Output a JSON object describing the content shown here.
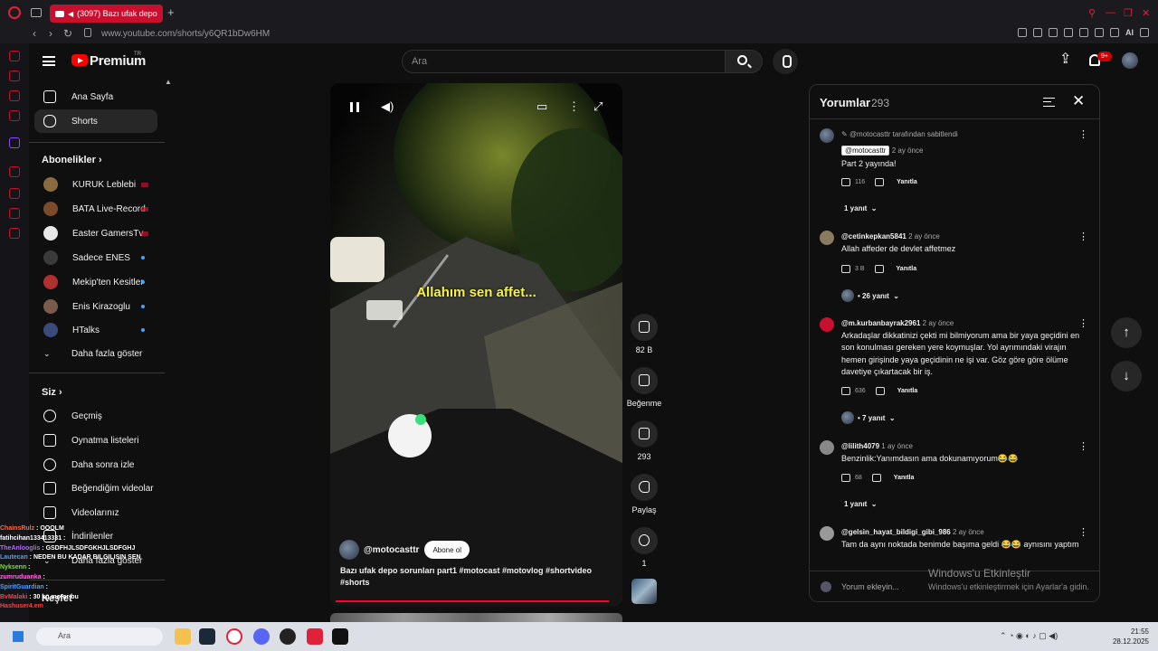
{
  "browser": {
    "tab_title": "(3097) Bazı ufak depo",
    "url": "www.youtube.com/shorts/y6QR1bDw6HM",
    "ai_label": "AI"
  },
  "header": {
    "brand": "Premium",
    "brand_sup": "TR",
    "search_placeholder": "Ara",
    "notif_badge": "9+"
  },
  "sidebar": {
    "main_items": [
      {
        "label": "Ana Sayfa"
      },
      {
        "label": "Shorts"
      }
    ],
    "subs_heading": "Abonelikler",
    "subs": [
      {
        "label": "KURUK Leblebi",
        "color": "#8a6a40"
      },
      {
        "label": "BATA Live-Record",
        "color": "#7a4a2a"
      },
      {
        "label": "Easter GamersTv",
        "color": "#e8e8e8"
      },
      {
        "label": "Sadece ENES",
        "color": "#3a3a3a"
      },
      {
        "label": "Mekip'ten Kesitler",
        "color": "#b03030"
      },
      {
        "label": "Enis Kirazoglu",
        "color": "#7a5a4a"
      },
      {
        "label": "HTalks",
        "color": "#3a4a7a"
      }
    ],
    "show_more": "Daha fazla göster",
    "you_heading": "Siz",
    "you_items": [
      {
        "label": "Geçmiş"
      },
      {
        "label": "Oynatma listeleri"
      },
      {
        "label": "Daha sonra izle"
      },
      {
        "label": "Beğendiğim videolar"
      },
      {
        "label": "Videolarınız"
      },
      {
        "label": "İndirilenler"
      },
      {
        "label": "Daha fazla göster"
      }
    ],
    "explore_heading": "Keşfet"
  },
  "short": {
    "subtitle": "Allahım sen affet...",
    "channel": "@motocasttr",
    "subscribe": "Abone ol",
    "caption_plain": "Bazı ufak depo sorunları part1 ",
    "caption_tags": "#motocast #motovlog #shortvideo #shorts",
    "progress": 0.97
  },
  "actions": {
    "likes": "82 B",
    "dislike": "Beğenme",
    "comments": "293",
    "share": "Paylaş",
    "remix": "1"
  },
  "comments_panel": {
    "title": "Yorumlar",
    "count": "293",
    "footer_placeholder": "Yorum ekleyin...",
    "reply_label": "Yanıtla",
    "items": [
      {
        "pinned_by": "@motocasttr tarafından sabitlendi",
        "author": "@motocasttr",
        "time": "2 ay önce",
        "text": "Part 2 yayında!",
        "likes": "116",
        "replies": "1 yanıt"
      },
      {
        "author": "@cetinkepkan5841",
        "time": "2 ay önce",
        "text": "Allah affeder de devlet affetmez",
        "likes": "3 B",
        "replies": "• 26 yanıt"
      },
      {
        "author": "@m.kurbanbayrak2961",
        "time": "2 ay önce",
        "text": "Arkadaşlar dikkatinizi çekti mi bilmiyorum ama bir yaya geçidini en son konulması gereken yere koymuşlar. Yol ayrımındaki virajın hemen girişinde yaya geçidinin ne işi var. Göz göre göre ölüme davetiye çıkartacak bir iş.",
        "likes": "636",
        "replies": "• 7 yanıt"
      },
      {
        "author": "@lilith4079",
        "time": "1 ay önce",
        "text": "Benzinlik:Yanımdasın ama dokunamıyorum😂😂",
        "likes": "68",
        "replies": "1 yanıt"
      },
      {
        "author": "@gelsin_hayat_bildigi_gibi_986",
        "time": "2 ay önce",
        "text": "Tam da aynı noktada benimde başıma geldi 😂😂 aynısını yaptım",
        "likes": "",
        "replies": ""
      }
    ]
  },
  "watermark": {
    "line1": "Windows'u Etkinleştir",
    "line2": "Windows'u etkinleştirmek için Ayarlar'a gidin."
  },
  "chat": [
    {
      "user": "ChainsRulz",
      "msg": ": OOOLM",
      "color": "#ff6a3d"
    },
    {
      "user": "fatihcihan133413331",
      "msg": ":",
      "color": "#ffffff"
    },
    {
      "user": "TheAnlooglis",
      "msg": ": GSDFHJLSDFGKHJLSDFGHJ",
      "color": "#b06aff"
    },
    {
      "user": "Lautecan",
      "msg": ": NEDEN BU KADAR BILGILISIN SEN",
      "color": "#4aa0ff"
    },
    {
      "user": "Nyksenn",
      "msg": ":",
      "color": "#7adf3a"
    },
    {
      "user": "zumruduanka",
      "msg": ":",
      "color": "#ff6adf"
    },
    {
      "user": "SpiritGuardian",
      "msg": ":",
      "color": "#4aa0ff"
    },
    {
      "user": "BvMalaki",
      "msg": ": 30 kg motor bu",
      "color": "#ff4040"
    },
    {
      "user": "Hashuser4.em",
      "msg": "",
      "color": "#ff4040"
    }
  ],
  "taskbar": {
    "search_label": "Ara",
    "time": "21:55",
    "date": "28.12.2025"
  }
}
